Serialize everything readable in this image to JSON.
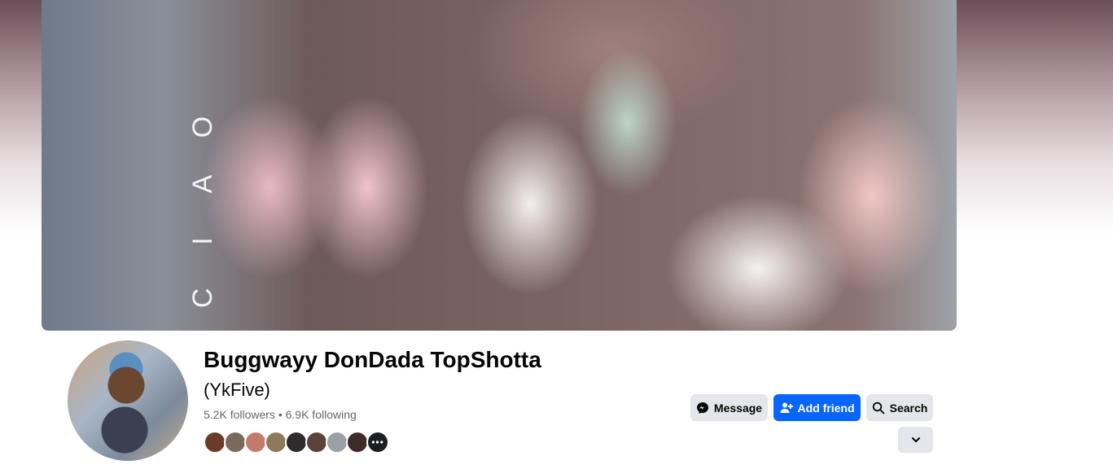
{
  "cover": {
    "overlay_text": [
      "C",
      "I",
      "A",
      "O"
    ]
  },
  "profile": {
    "name": "Buggwayy DonDada TopShotta",
    "alternate_name": "(YkFive)",
    "stats": "5.2K followers • 6.9K following"
  },
  "mutual_friends": {
    "colors": [
      "#6b3a2a",
      "#7a6a5c",
      "#c27b6a",
      "#8c7a5a",
      "#2f2a2b",
      "#5a4338",
      "#9aa0a6",
      "#3b2c29"
    ],
    "more_label": "•••"
  },
  "actions": {
    "message_label": "Message",
    "add_friend_label": "Add friend",
    "search_label": "Search"
  },
  "colors": {
    "accent": "#0866ff",
    "button_gray": "#e4e6eb",
    "text_primary": "#050505",
    "text_secondary": "#65676b"
  }
}
